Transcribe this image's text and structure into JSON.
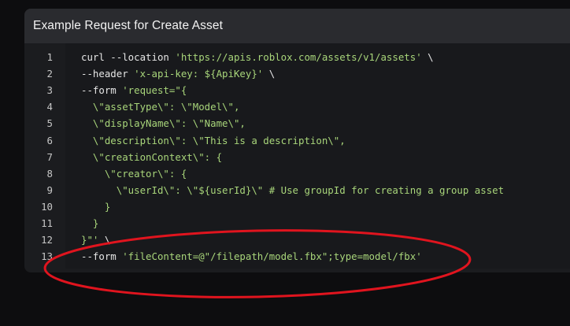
{
  "card": {
    "title": "Example Request for Create Asset"
  },
  "code": {
    "lines": [
      {
        "num": "1",
        "parts": [
          {
            "t": "curl --location ",
            "c": "cmd"
          },
          {
            "t": "'https://apis.roblox.com/assets/v1/assets'",
            "c": "str"
          },
          {
            "t": " \\",
            "c": "plain"
          }
        ]
      },
      {
        "num": "2",
        "parts": [
          {
            "t": "--header ",
            "c": "cmd"
          },
          {
            "t": "'x-api-key: ${ApiKey}'",
            "c": "str"
          },
          {
            "t": " \\",
            "c": "plain"
          }
        ]
      },
      {
        "num": "3",
        "parts": [
          {
            "t": "--form ",
            "c": "cmd"
          },
          {
            "t": "'request=\"{",
            "c": "str"
          }
        ]
      },
      {
        "num": "4",
        "parts": [
          {
            "t": "  \\\"assetType\\\": \\\"Model\\\",",
            "c": "str"
          }
        ]
      },
      {
        "num": "5",
        "parts": [
          {
            "t": "  \\\"displayName\\\": \\\"Name\\\",",
            "c": "str"
          }
        ]
      },
      {
        "num": "6",
        "parts": [
          {
            "t": "  \\\"description\\\": \\\"This is a description\\\",",
            "c": "str"
          }
        ]
      },
      {
        "num": "7",
        "parts": [
          {
            "t": "  \\\"creationContext\\\": {",
            "c": "str"
          }
        ]
      },
      {
        "num": "8",
        "parts": [
          {
            "t": "    \\\"creator\\\": {",
            "c": "str"
          }
        ]
      },
      {
        "num": "9",
        "parts": [
          {
            "t": "      \\\"userId\\\": \\\"${userId}\\\" # Use groupId for creating a group asset",
            "c": "str"
          }
        ]
      },
      {
        "num": "10",
        "parts": [
          {
            "t": "    }",
            "c": "str"
          }
        ]
      },
      {
        "num": "11",
        "parts": [
          {
            "t": "  }",
            "c": "str"
          }
        ]
      },
      {
        "num": "12",
        "parts": [
          {
            "t": "}\"'",
            "c": "str"
          },
          {
            "t": " \\",
            "c": "plain"
          }
        ]
      },
      {
        "num": "13",
        "parts": [
          {
            "t": "--form ",
            "c": "cmd"
          },
          {
            "t": "'fileContent=@\"/filepath/model.fbx\";type=model/fbx'",
            "c": "str"
          }
        ]
      }
    ]
  },
  "annotation": {
    "shape": "red-ellipse",
    "color": "#e0141e"
  }
}
